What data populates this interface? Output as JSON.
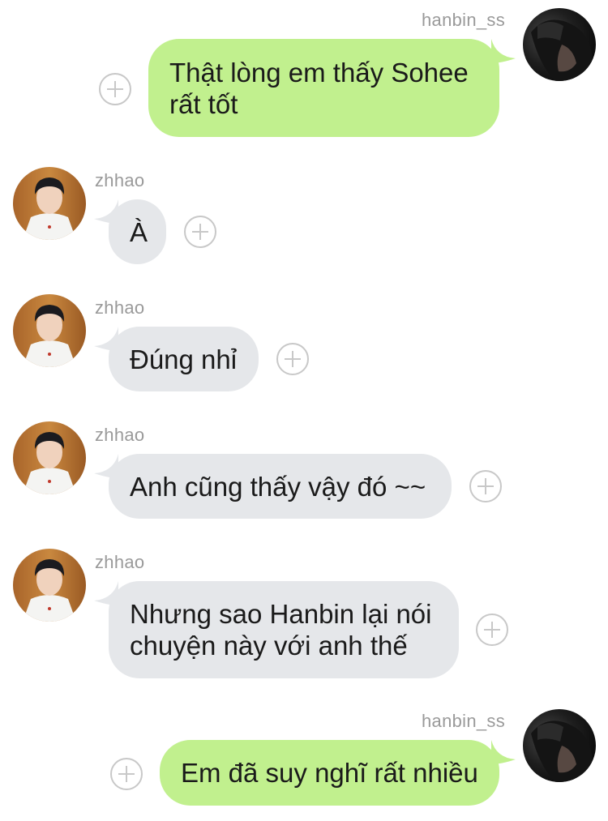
{
  "colors": {
    "outgoing_bubble": "#c1f08e",
    "incoming_bubble": "#e5e7ea",
    "username_text": "#9a9a9a",
    "plus_icon": "#c8c8c8"
  },
  "messages": [
    {
      "direction": "outgoing",
      "sender": "hanbin_ss",
      "text": "Thật lòng em thấy Sohee\nrất tốt",
      "add_icon": "plus-circle-icon"
    },
    {
      "direction": "incoming",
      "sender": "zhhao",
      "text": "À",
      "add_icon": "plus-circle-icon"
    },
    {
      "direction": "incoming",
      "sender": "zhhao",
      "text": "Đúng nhỉ",
      "add_icon": "plus-circle-icon"
    },
    {
      "direction": "incoming",
      "sender": "zhhao",
      "text": "Anh cũng thấy vậy đó ~~",
      "add_icon": "plus-circle-icon"
    },
    {
      "direction": "incoming",
      "sender": "zhhao",
      "text": "Nhưng sao Hanbin lại nói\nchuyện này với anh thế",
      "add_icon": "plus-circle-icon"
    },
    {
      "direction": "outgoing",
      "sender": "hanbin_ss",
      "text": "Em đã suy nghĩ rất nhiều",
      "add_icon": "plus-circle-icon"
    }
  ]
}
